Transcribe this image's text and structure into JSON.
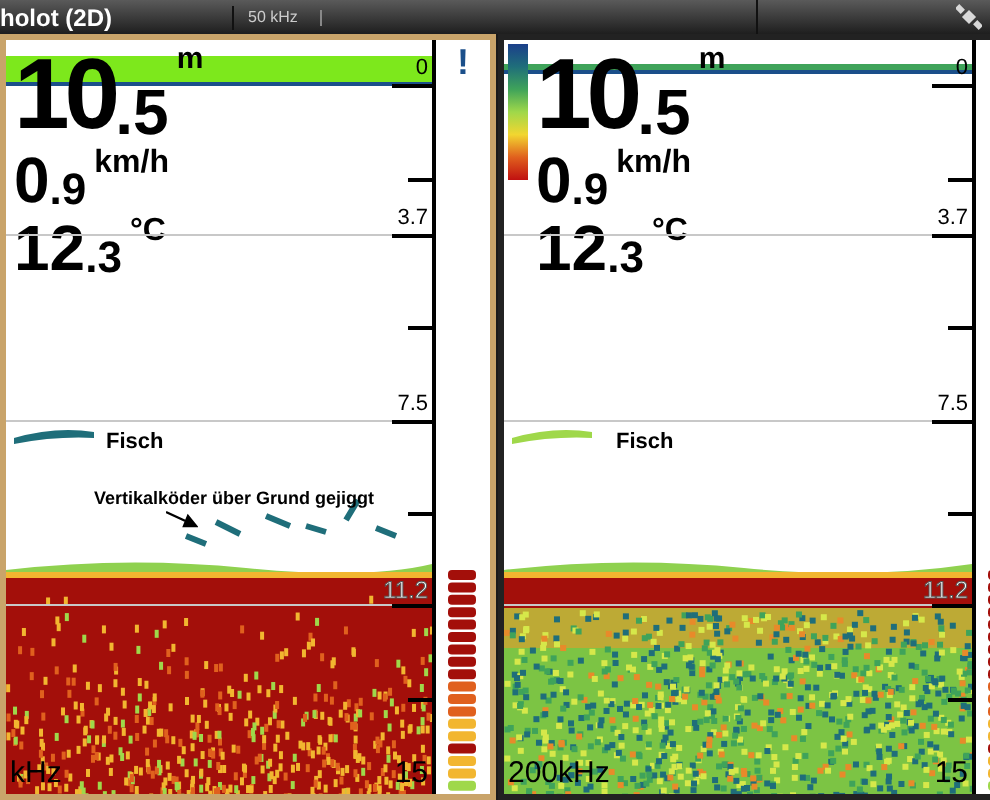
{
  "title_bar": {
    "title": "holot (2D)",
    "frequency_tab": "50 kHz"
  },
  "panels": [
    {
      "selected": true,
      "kind": "coarse",
      "legend": false,
      "alert": "!",
      "depth": {
        "whole": "10",
        "decimal": ".5",
        "unit": "m"
      },
      "speed": {
        "whole": "0",
        "decimal": ".9",
        "unit": "km/h"
      },
      "temperature": {
        "whole": "12",
        "decimal": ".3",
        "unit": "°C"
      },
      "scale": [
        "0",
        "3.7",
        "7.5",
        "11.2",
        "15"
      ],
      "frequency": "kHz",
      "annotations": [
        {
          "kind": "plain",
          "text": "Fisch"
        },
        {
          "kind": "arrow",
          "text": "Vertikalköder über Grund gejiggt"
        }
      ]
    },
    {
      "selected": false,
      "kind": "fine",
      "legend": true,
      "depth": {
        "whole": "10",
        "decimal": ".5",
        "unit": "m"
      },
      "speed": {
        "whole": "0",
        "decimal": ".9",
        "unit": "km/h"
      },
      "temperature": {
        "whole": "12",
        "decimal": ".3",
        "unit": "°C"
      },
      "scale": [
        "0",
        "3.7",
        "7.5",
        "11.2",
        "15"
      ],
      "frequency": "200kHz",
      "annotations": [
        {
          "kind": "plain",
          "text": "Fisch"
        }
      ]
    }
  ]
}
